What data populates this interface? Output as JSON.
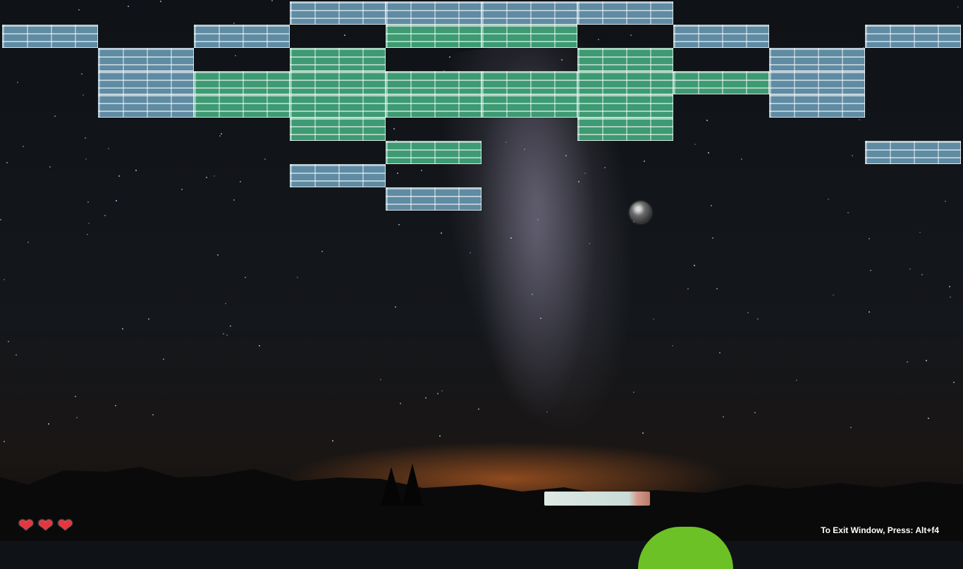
{
  "hud": {
    "exit_hint": "To Exit Window, Press: Alt+f4",
    "lives": 3,
    "heart_glyph": "❤"
  },
  "colors": {
    "blue_brick": "#5f8ba3",
    "green_brick": "#3d9a72",
    "heart": "#e8353d",
    "tent": "#6cc126"
  }
}
